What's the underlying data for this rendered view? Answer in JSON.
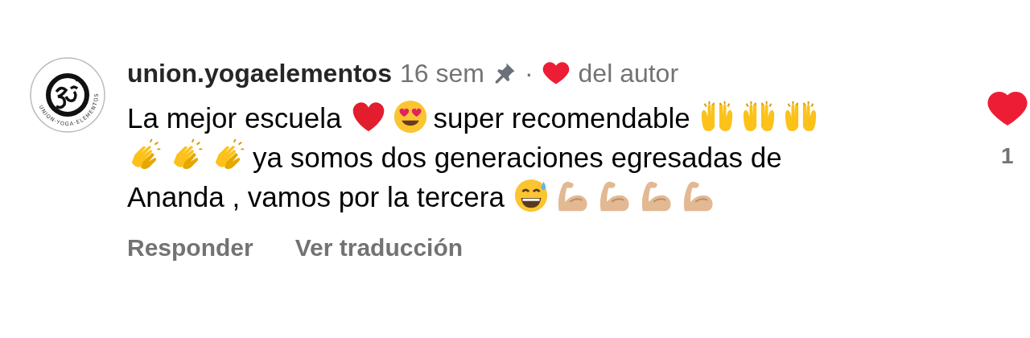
{
  "comment": {
    "avatar": {
      "logo_text": "UNION·YOGA·ELEMENTOS"
    },
    "username": "union.yogaelementos",
    "time": "16 sem",
    "pinned": true,
    "separator": "·",
    "liked_by_author": true,
    "author_label": "del autor",
    "body": [
      {
        "kind": "text",
        "text": "La mejor escuela"
      },
      {
        "kind": "heart"
      },
      {
        "kind": "heart-eyes"
      },
      {
        "kind": "text",
        "text": "super recomendable"
      },
      {
        "kind": "raised-hands"
      },
      {
        "kind": "raised-hands"
      },
      {
        "kind": "raised-hands"
      },
      {
        "kind": "clap"
      },
      {
        "kind": "clap"
      },
      {
        "kind": "clap"
      },
      {
        "kind": "text",
        "text": "ya somos dos generaciones egresadas de Ananda , vamos por la tercera"
      },
      {
        "kind": "sweat-smile"
      },
      {
        "kind": "muscle"
      },
      {
        "kind": "muscle"
      },
      {
        "kind": "muscle"
      },
      {
        "kind": "muscle"
      }
    ],
    "actions": [
      {
        "label": "Responder"
      },
      {
        "label": "Ver traducción"
      }
    ],
    "liked": true,
    "like_count": "1"
  }
}
